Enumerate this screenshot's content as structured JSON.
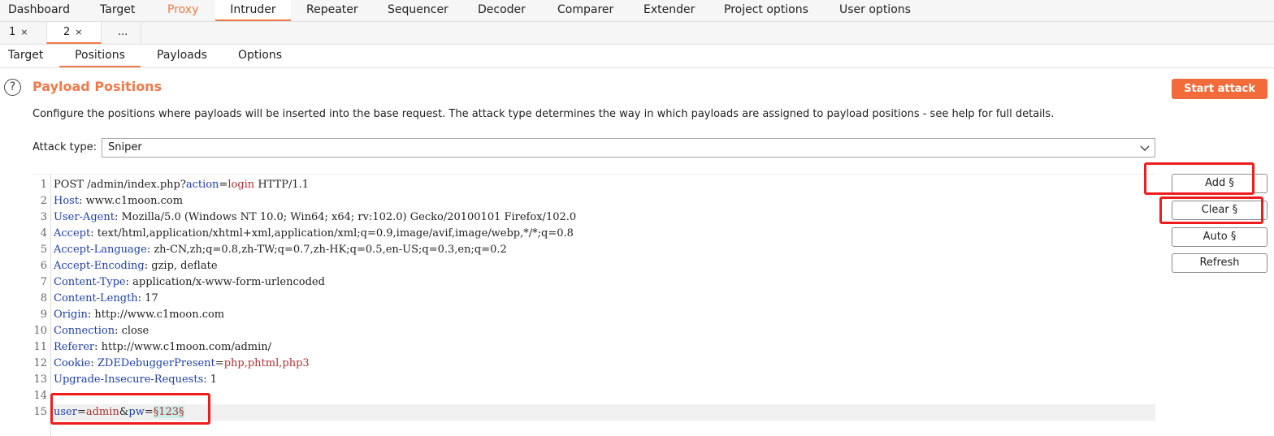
{
  "main_tabs": [
    "Dashboard",
    "Target",
    "Proxy",
    "Intruder",
    "Repeater",
    "Sequencer",
    "Decoder",
    "Comparer",
    "Extender",
    "Project options",
    "User options"
  ],
  "sub_tabs": [
    {
      "label": "1",
      "close": "×"
    },
    {
      "label": "2",
      "close": "×"
    },
    {
      "label": "..."
    }
  ],
  "inner_tabs": [
    "Target",
    "Positions",
    "Payloads",
    "Options"
  ],
  "panel": {
    "help_icon": "?",
    "title": "Payload Positions",
    "description": "Configure the positions where payloads will be inserted into the base request. The attack type determines the way in which payloads are assigned to payload positions - see help for full details.",
    "start_attack": "Start attack",
    "attack_type_label": "Attack type:",
    "attack_type_value": "Sniper"
  },
  "side_buttons": {
    "add": "Add §",
    "clear": "Clear §",
    "auto": "Auto §",
    "refresh": "Refresh"
  },
  "request": {
    "line_numbers": [
      "1",
      "2",
      "3",
      "4",
      "5",
      "6",
      "7",
      "8",
      "9",
      "10",
      "11",
      "12",
      "13",
      "14",
      "15"
    ],
    "line1": {
      "a": "POST /admin/index.php?",
      "b": "action",
      "c": "=",
      "d": "login",
      "e": " HTTP/1.1"
    },
    "headers": [
      {
        "name": "Host",
        "value": "www.c1moon.com"
      },
      {
        "name": "User-Agent",
        "value": "Mozilla/5.0 (Windows NT 10.0; Win64; x64; rv:102.0) Gecko/20100101 Firefox/102.0"
      },
      {
        "name": "Accept",
        "value": "text/html,application/xhtml+xml,application/xml;q=0.9,image/avif,image/webp,*/*;q=0.8"
      },
      {
        "name": "Accept-Language",
        "value": "zh-CN,zh;q=0.8,zh-TW;q=0.7,zh-HK;q=0.5,en-US;q=0.3,en;q=0.2"
      },
      {
        "name": "Accept-Encoding",
        "value": "gzip, deflate"
      },
      {
        "name": "Content-Type",
        "value": "application/x-www-form-urlencoded"
      },
      {
        "name": "Content-Length",
        "value": "17"
      },
      {
        "name": "Origin",
        "value": "http://www.c1moon.com"
      },
      {
        "name": "Connection",
        "value": "close"
      },
      {
        "name": "Referer",
        "value": "http://www.c1moon.com/admin/"
      }
    ],
    "cookie": {
      "name": "Cookie",
      "k": "ZDEDebuggerPresent",
      "eq": "=",
      "v": "php,phtml,php3"
    },
    "upgrade": {
      "name": "Upgrade-Insecure-Requests",
      "value": "1"
    },
    "colon": ": ",
    "body": {
      "k1": "user",
      "eq1": "=",
      "v1": "admin",
      "amp": "&",
      "k2": "pw",
      "eq2": "=",
      "mark": "§123§"
    }
  }
}
